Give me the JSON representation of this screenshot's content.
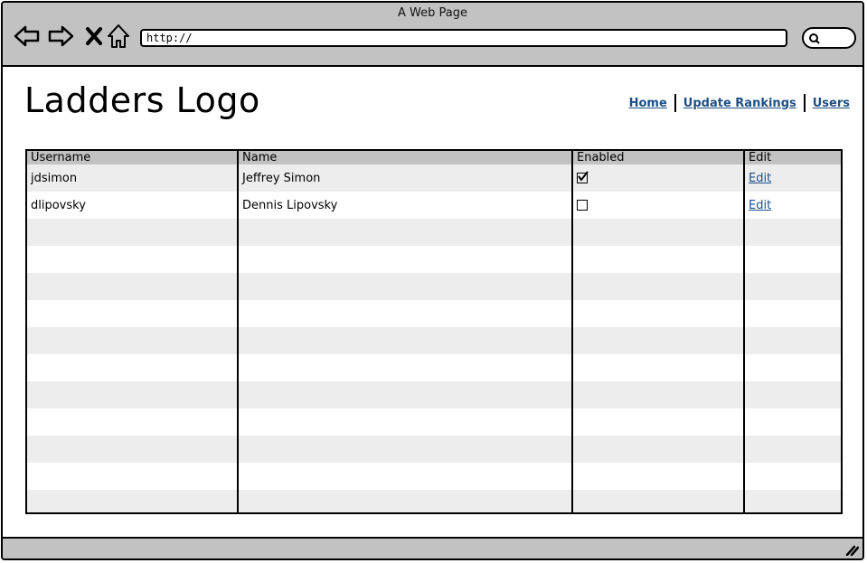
{
  "window": {
    "title": "A Web Page"
  },
  "browser": {
    "url": "http://"
  },
  "site": {
    "logo": "Ladders Logo"
  },
  "nav": {
    "home": "Home",
    "update_rankings": "Update Rankings",
    "users": "Users"
  },
  "table": {
    "headers": {
      "username": "Username",
      "name": "Name",
      "enabled": "Enabled",
      "edit": "Edit"
    },
    "rows": [
      {
        "username": "jdsimon",
        "name": "Jeffrey Simon",
        "enabled": true,
        "edit": "Edit"
      },
      {
        "username": "dlipovsky",
        "name": "Dennis Lipovsky",
        "enabled": false,
        "edit": "Edit"
      }
    ],
    "empty_rows": 11
  },
  "colors": {
    "chrome": "#c2c2c2",
    "link": "#1d4f86",
    "stripe": "#ededed"
  }
}
